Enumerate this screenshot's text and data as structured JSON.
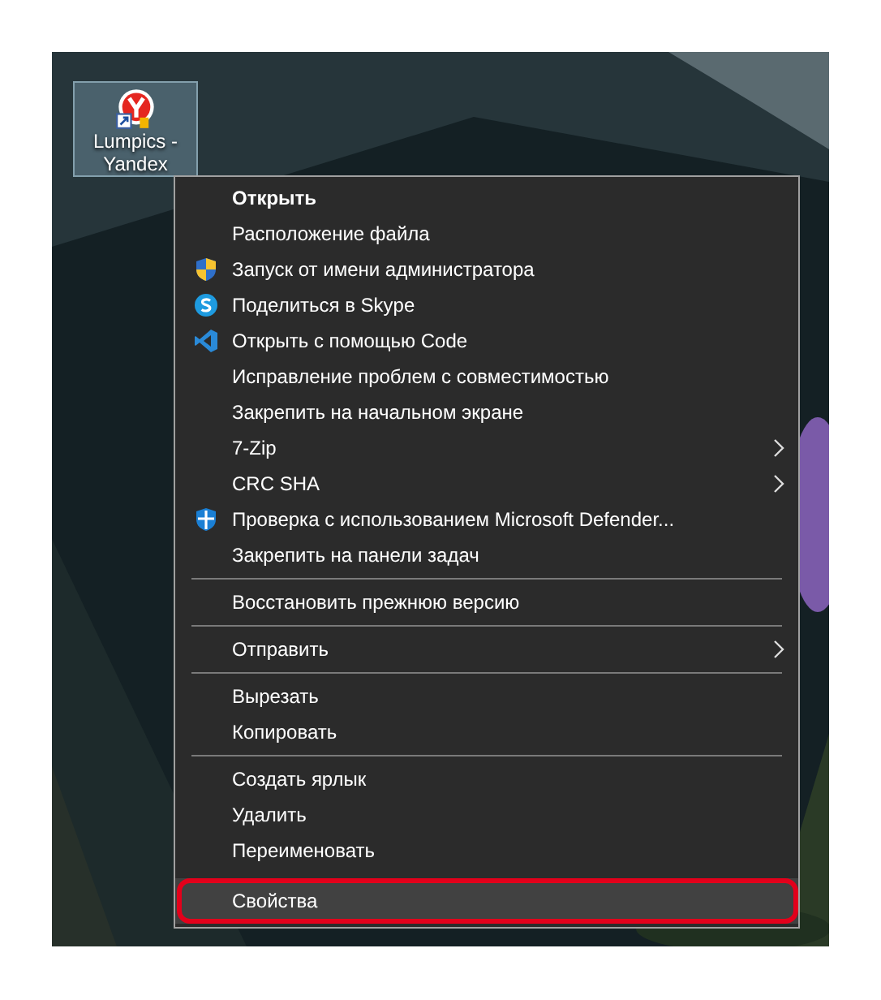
{
  "desktop_icon": {
    "label": "Lumpics - Yandex",
    "selected": true
  },
  "context_menu": {
    "groups": [
      [
        {
          "label": "Открыть",
          "bold": true
        },
        {
          "label": "Расположение файла"
        },
        {
          "label": "Запуск от имени администратора",
          "kind": "uac-shield"
        },
        {
          "label": "Поделиться в Skype",
          "kind": "skype"
        },
        {
          "label": "Открыть с помощью Code",
          "kind": "code"
        },
        {
          "label": "Исправление проблем с совместимостью"
        },
        {
          "label": "Закрепить на начальном экране"
        },
        {
          "label": "7-Zip",
          "submenu": true
        },
        {
          "label": "CRC SHA",
          "submenu": true
        },
        {
          "label": "Проверка с использованием Microsoft Defender...",
          "kind": "defender"
        },
        {
          "label": "Закрепить на панели задач"
        }
      ],
      [
        {
          "label": "Восстановить прежнюю версию"
        }
      ],
      [
        {
          "label": "Отправить",
          "submenu": true
        }
      ],
      [
        {
          "label": "Вырезать"
        },
        {
          "label": "Копировать"
        }
      ],
      [
        {
          "label": "Создать ярлык"
        },
        {
          "label": "Удалить"
        },
        {
          "label": "Переименовать"
        },
        {
          "label": "Свойства",
          "selected": true,
          "outlined": true
        }
      ]
    ]
  }
}
